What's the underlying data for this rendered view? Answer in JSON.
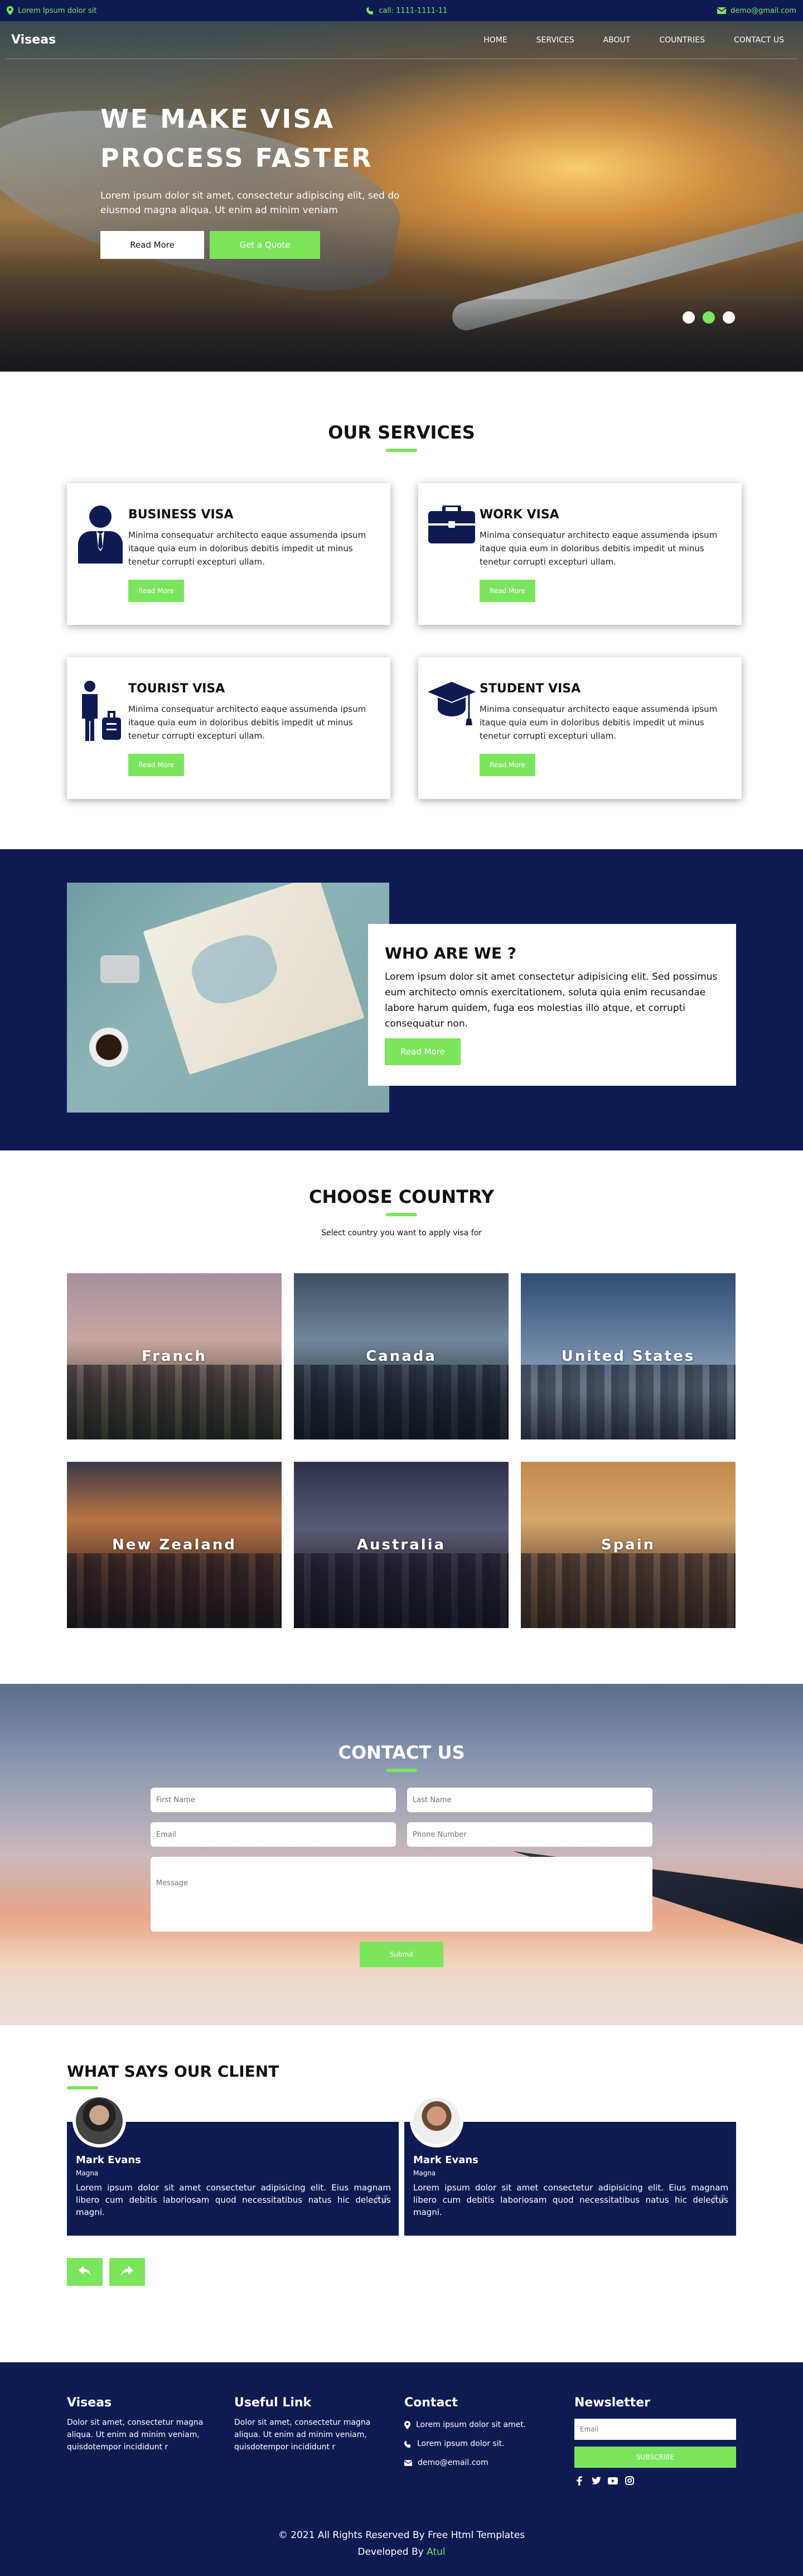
{
  "topbar": {
    "location": "Lorem Ipsum dolor sit",
    "phone": "call: 1111-1111-11",
    "email": "demo@gmail.com"
  },
  "nav": {
    "logo": "Viseas",
    "items": [
      "HOME",
      "SERVICES",
      "ABOUT",
      "COUNTRIES",
      "CONTACT US"
    ]
  },
  "hero": {
    "title_line1": "WE MAKE VISA",
    "title_line2": "PROCESS FASTER",
    "text": "Lorem ipsum dolor sit amet, consectetur adipiscing elit, sed do eiusmod magna aliqua. Ut enim ad minim veniam",
    "read_more": "Read More",
    "get_quote": "Get a Quote",
    "slides": 3,
    "active_slide": 1
  },
  "services": {
    "title": "OUR SERVICES",
    "items": [
      {
        "title": "BUSINESS VISA",
        "text": "Minima consequatur architecto eaque assumenda ipsum itaque quia eum in doloribus debitis impedit ut minus tenetur corrupti excepturi ullam.",
        "button": "Read More",
        "icon": "businessman-icon"
      },
      {
        "title": "WORK VISA",
        "text": "Minima consequatur architecto eaque assumenda ipsum itaque quia eum in doloribus debitis impedit ut minus tenetur corrupti excepturi ullam.",
        "button": "Read More",
        "icon": "briefcase-icon"
      },
      {
        "title": "TOURIST VISA",
        "text": "Minima consequatur architecto eaque assumenda ipsum itaque quia eum in doloribus debitis impedit ut minus tenetur corrupti excepturi ullam.",
        "button": "Read More",
        "icon": "tourist-icon"
      },
      {
        "title": "STUDENT VISA",
        "text": "Minima consequatur architecto eaque assumenda ipsum itaque quia eum in doloribus debitis impedit ut minus tenetur corrupti excepturi ullam.",
        "button": "Read More",
        "icon": "graduation-cap-icon"
      }
    ]
  },
  "who": {
    "title": "WHO ARE WE ?",
    "text": "Lorem ipsum dolor sit amet consectetur adipisicing elit. Sed possimus eum architecto omnis exercitationem, soluta quia enim recusandae labore harum quidem, fuga eos molestias illo atque, et corrupti consequatur non.",
    "button": "Read More"
  },
  "choose": {
    "title": "CHOOSE COUNTRY",
    "subtitle": "Select country you want to apply visa for",
    "countries": [
      "Franch",
      "Canada",
      "United States",
      "New Zealand",
      "Australia",
      "Spain"
    ]
  },
  "contact": {
    "title": "CONTACT US",
    "first_name": "First Name",
    "last_name": "Last Name",
    "email": "Email",
    "phone": "Phone Number",
    "message": "Message",
    "submit": "Submit"
  },
  "clients": {
    "title": "WHAT SAYS OUR CLIENT",
    "items": [
      {
        "name": "Mark Evans",
        "role": "Magna",
        "text": "Lorem ipsum dolor sit amet consectetur adipisicing elit. Eius magnam libero cum debitis laboriosam quod necessitatibus natus hic delectus magni."
      },
      {
        "name": "Mark Evans",
        "role": "Magna",
        "text": "Lorem ipsum dolor sit amet consectetur adipisicing elit. Eius magnam libero cum debitis laboriosam quod necessitatibus natus hic delectus magni."
      }
    ],
    "prev_icon": "reply-icon",
    "next_icon": "share-icon"
  },
  "footer": {
    "col1_title": "Viseas",
    "col1_text": "Dolor sit amet, consectetur magna aliqua. Ut enim ad minim veniam, quisdotempor incididunt r",
    "col2_title": "Useful Link",
    "col2_text": "Dolor sit amet, consectetur magna aliqua. Ut enim ad minim veniam, quisdotempor incididunt r",
    "col3_title": "Contact",
    "contact_items": [
      "Lorem ipsum dolor sit amet.",
      "Lorem ipsum dolor sit.",
      "demo@email.com"
    ],
    "col4_title": "Newsletter",
    "newsletter_placeholder": "Email",
    "subscribe": "SUBSCRIBE",
    "copyright": "© 2021 All Rights Reserved By Free Html Templates",
    "developed_by": "Developed By ",
    "author": "Atul"
  },
  "colors": {
    "navy": "#0e1b53",
    "green": "#7ce55e"
  }
}
